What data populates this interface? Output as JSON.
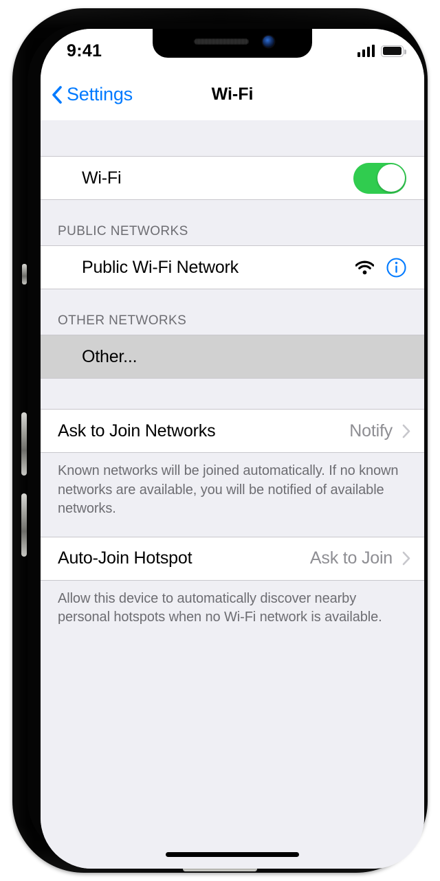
{
  "status_bar": {
    "time": "9:41",
    "signal_icon": "cellular-signal-icon",
    "battery_icon": "battery-icon"
  },
  "nav_bar": {
    "back_label": "Settings",
    "back_icon": "chevron-left-icon",
    "title": "Wi-Fi"
  },
  "sections": {
    "wifi_toggle": {
      "label": "Wi-Fi",
      "state": "on",
      "toggle_color": "#30cc4f"
    },
    "public_networks": {
      "header": "PUBLIC NETWORKS",
      "network_name": "Public Wi-Fi Network",
      "wifi_icon": "wifi-signal-icon",
      "info_icon": "info-circle-icon",
      "info_color": "#007aff"
    },
    "other_networks": {
      "header": "OTHER NETWORKS",
      "other_label": "Other...",
      "highlight_color": "#d1d1d1"
    },
    "ask_to_join": {
      "label": "Ask to Join Networks",
      "value": "Notify",
      "chevron_icon": "chevron-right-icon",
      "footer": "Known networks will be joined automatically. If no known networks are available, you will be notified of available networks."
    },
    "auto_join_hotspot": {
      "label": "Auto-Join Hotspot",
      "value": "Ask to Join",
      "chevron_icon": "chevron-right-icon",
      "footer": "Allow this device to automatically discover nearby personal hotspots when no Wi-Fi network is available."
    }
  },
  "home_indicator": "home-indicator"
}
